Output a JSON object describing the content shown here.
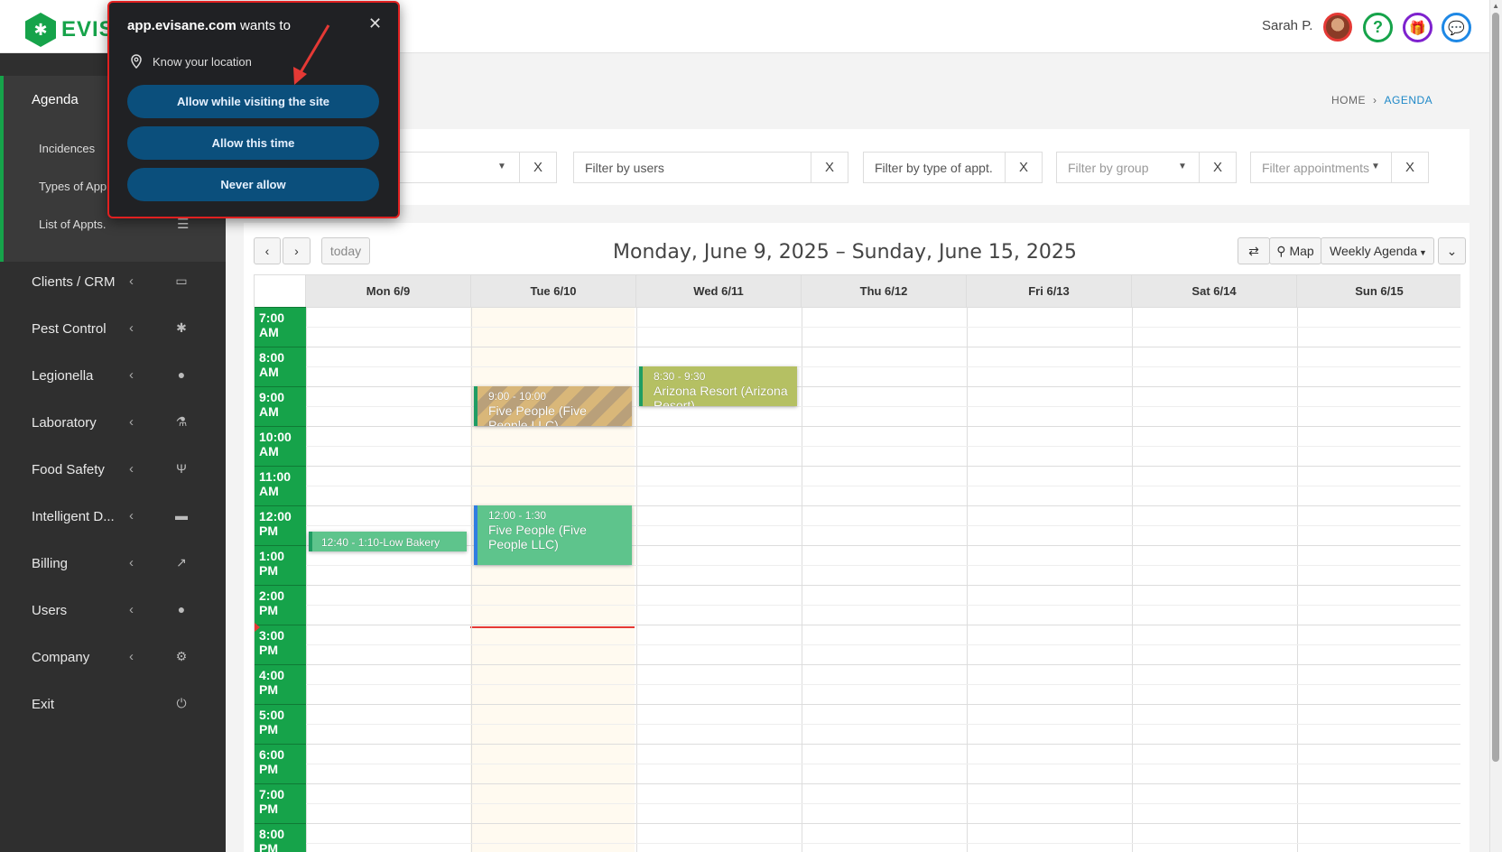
{
  "header": {
    "logo_text": "EVIS",
    "user_name": "Sarah P.",
    "help_icon": "?",
    "gift_icon": "🎁",
    "chat_icon": "💬"
  },
  "sidebar": {
    "agenda_label": "Agenda",
    "agenda_sub": [
      {
        "label": "Incidences"
      },
      {
        "label": "Types of App"
      },
      {
        "label": "List of Appts.",
        "icon": "☰"
      }
    ],
    "items": [
      {
        "label": "Clients / CRM",
        "icon": "▭"
      },
      {
        "label": "Pest Control",
        "icon": "✱"
      },
      {
        "label": "Legionella",
        "icon": "●"
      },
      {
        "label": "Laboratory",
        "icon": "⚗"
      },
      {
        "label": "Food Safety",
        "icon": "Ψ"
      },
      {
        "label": "Intelligent D...",
        "icon": "▬"
      },
      {
        "label": "Billing",
        "icon": "↗"
      },
      {
        "label": "Users",
        "icon": "●"
      },
      {
        "label": "Company",
        "icon": "⚙"
      },
      {
        "label": "Exit",
        "icon": "⏻"
      }
    ],
    "chevron": "‹"
  },
  "breadcrumb": {
    "home": "HOME",
    "sep": "›",
    "current": "AGENDA"
  },
  "filters": {
    "users_placeholder": "Filter by users",
    "type_placeholder": "Filter by type of appt.",
    "group_placeholder": "Filter by group",
    "appointments_placeholder": "Filter appointments",
    "clear_label": "X"
  },
  "calendar": {
    "prev": "‹",
    "next": "›",
    "today": "today",
    "title": "Monday, June 9, 2025 – Sunday, June 15, 2025",
    "swap_icon": "⇄",
    "map_label": "Map",
    "view_label": "Weekly Agenda",
    "expand_icon": "⌄",
    "days": [
      "Mon 6/9",
      "Tue 6/10",
      "Wed 6/11",
      "Thu 6/12",
      "Fri 6/13",
      "Sat 6/14",
      "Sun 6/15"
    ],
    "times": [
      "7:00 AM",
      "8:00 AM",
      "9:00 AM",
      "10:00 AM",
      "11:00 AM",
      "12:00 PM",
      "1:00 PM",
      "2:00 PM",
      "3:00 PM",
      "4:00 PM",
      "5:00 PM",
      "6:00 PM",
      "7:00 PM",
      "8:00 PM"
    ],
    "events": [
      {
        "time": "9:00 - 10:00",
        "name": "Five People (Five People LLC)",
        "day": "Tue 6/10",
        "color": "#d9b779"
      },
      {
        "time": "8:30 - 9:30",
        "name": "Arizona Resort (Arizona Resort)",
        "day": "Wed 6/11",
        "color": "#b5c063"
      },
      {
        "time": "12:00 - 1:30",
        "name": "Five People (Five People LLC)",
        "day": "Tue 6/10",
        "color": "#5ec48c"
      },
      {
        "time": "12:40 - 1:10",
        "name": "Low Bakery",
        "day": "Mon 6/9",
        "color": "#5ec48c"
      }
    ]
  },
  "popup": {
    "domain": "app.evisane.com",
    "wants_to": " wants to",
    "close": "✕",
    "permission": "Know your location",
    "allow_visit": "Allow while visiting the site",
    "allow_once": "Allow this time",
    "never": "Never allow"
  }
}
